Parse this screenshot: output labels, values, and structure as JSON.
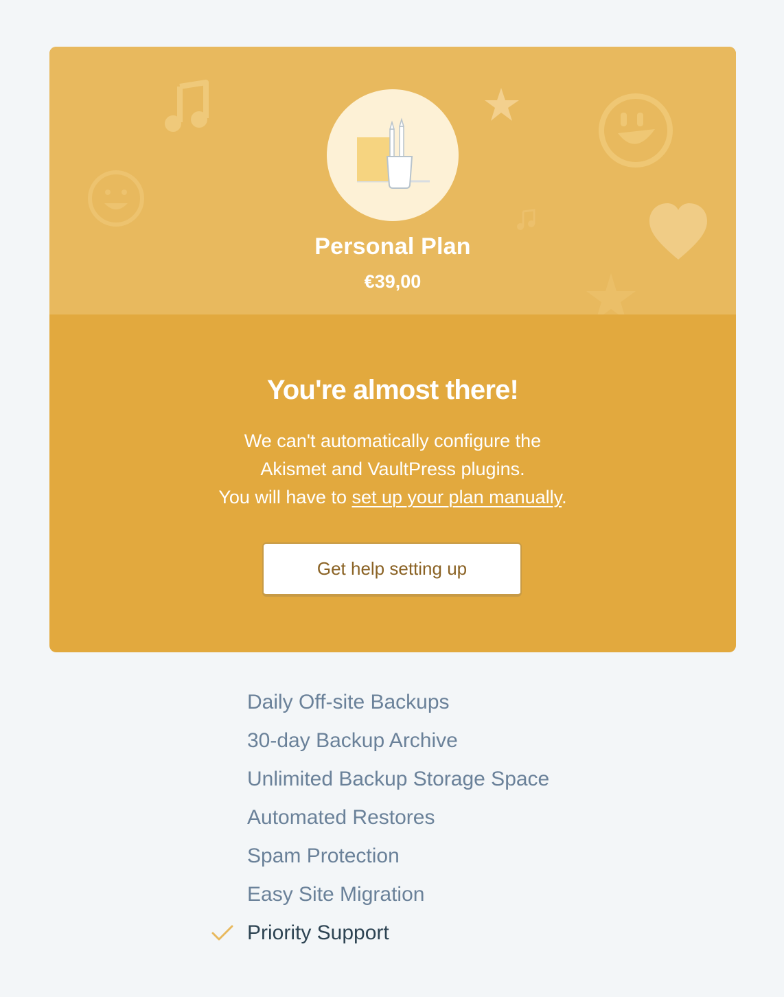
{
  "plan": {
    "name": "Personal Plan",
    "price": "€39,00",
    "icon": "pencil-cup-illustration"
  },
  "notice": {
    "headline": "You're almost there!",
    "line1": "We can't automatically configure the",
    "line2": "Akismet and VaultPress plugins.",
    "line3_prefix": "You will have to ",
    "line3_link": "set up your plan manually",
    "line3_suffix": ".",
    "button_label": "Get help setting up"
  },
  "features": [
    {
      "label": "Daily Off-site Backups",
      "included": false
    },
    {
      "label": "30-day Backup Archive",
      "included": false
    },
    {
      "label": "Unlimited Backup Storage Space",
      "included": false
    },
    {
      "label": "Automated Restores",
      "included": false
    },
    {
      "label": "Spam Protection",
      "included": false
    },
    {
      "label": "Easy Site Migration",
      "included": false
    },
    {
      "label": "Priority Support",
      "included": true,
      "icon": "checkmark-icon"
    }
  ],
  "colors": {
    "page_background": "#f3f6f8",
    "card_top": "#e8b95e",
    "card_bottom": "#e2a93e",
    "feature_text": "#6a8199",
    "feature_text_active": "#2e4453",
    "check": "#e8b95e"
  }
}
